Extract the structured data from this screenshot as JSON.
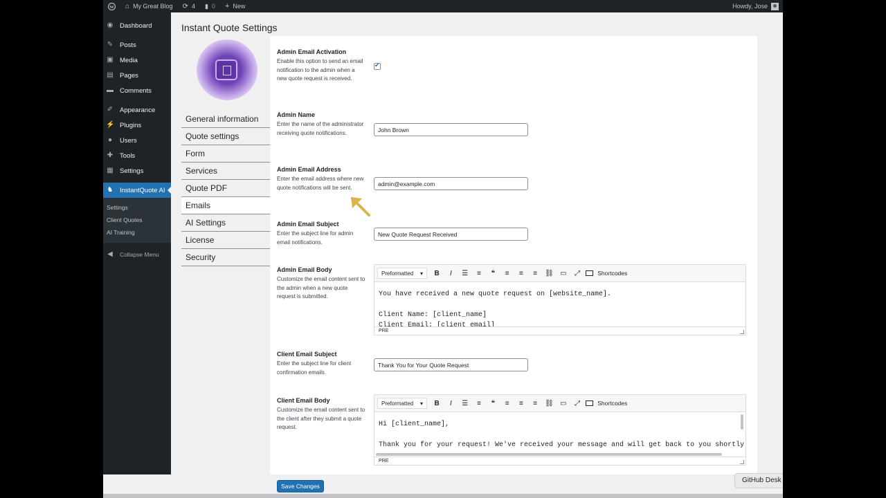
{
  "adminbar": {
    "site_name": "My Great Blog",
    "updates_count": "4",
    "comments_count": "0",
    "new_label": "New",
    "howdy": "Howdy, Jose"
  },
  "sidebar": {
    "items": [
      {
        "label": "Dashboard",
        "icon": "dashboard-icon"
      },
      {
        "label": "Posts",
        "icon": "pin-icon"
      },
      {
        "label": "Media",
        "icon": "media-icon"
      },
      {
        "label": "Pages",
        "icon": "pages-icon"
      },
      {
        "label": "Comments",
        "icon": "comment-icon"
      },
      {
        "label": "Appearance",
        "icon": "brush-icon"
      },
      {
        "label": "Plugins",
        "icon": "plug-icon"
      },
      {
        "label": "Users",
        "icon": "user-icon"
      },
      {
        "label": "Tools",
        "icon": "wrench-icon"
      },
      {
        "label": "Settings",
        "icon": "settings-icon"
      },
      {
        "label": "InstantQuote AI",
        "icon": "plugin-icon"
      }
    ],
    "submenu": [
      "Settings",
      "Client Quotes",
      "AI Training"
    ],
    "collapse_label": "Collapse Menu"
  },
  "page": {
    "title": "Instant Quote Settings"
  },
  "tabs": [
    "General information",
    "Quote settings",
    "Form",
    "Services",
    "Quote PDF",
    "Emails",
    "AI Settings",
    "License",
    "Security"
  ],
  "active_tab": "Emails",
  "fields": {
    "admin_activation": {
      "label": "Admin Email Activation",
      "desc": "Enable this option to send an email notification to the admin when a new quote request is received.",
      "checked": true
    },
    "admin_name": {
      "label": "Admin Name",
      "desc": "Enter the name of the administrator receiving quote notifications.",
      "value": "John Brown"
    },
    "admin_email": {
      "label": "Admin Email Address",
      "desc": "Enter the email address where new quote notifications will be sent.",
      "value": "admin@example.com"
    },
    "admin_subject": {
      "label": "Admin Email Subject",
      "desc": "Enter the subject line for admin email notifications.",
      "value": "New Quote Request Received"
    },
    "admin_body": {
      "label": "Admin Email Body",
      "desc": "Customize the email content sent to the admin when a new quote request is submitted.",
      "content": "You have received a new quote request on [website_name].\n\nClient Name: [client_name]\nClient Email: [client_email]"
    },
    "client_subject": {
      "label": "Client Email Subject",
      "desc": "Enter the subject line for client confirmation emails.",
      "value": "Thank You for Your Quote Request"
    },
    "client_body": {
      "label": "Client Email Body",
      "desc": "Customize the email content sent to the client after they submit a quote request.",
      "content": "Hi [client_name],\n\nThank you for your request! We've received your message and will get back to you shortly."
    }
  },
  "editor": {
    "format_label": "Preformatted",
    "shortcodes_label": "Shortcodes",
    "status_path": "PRE"
  },
  "save_label": "Save Changes",
  "github_label": "GitHub Desk",
  "colors": {
    "accent": "#2271b1",
    "sidebar_bg": "#1d2327",
    "arrow": "#d9b44a"
  }
}
